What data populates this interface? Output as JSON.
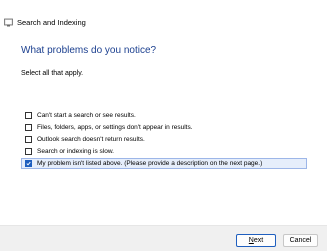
{
  "window": {
    "title": "Search and Indexing",
    "app_icon": "search-indexing-app-icon"
  },
  "wizard": {
    "heading": "What problems do you notice?",
    "instruction": "Select all that apply.",
    "options": [
      {
        "label": "Can't start a search or see results.",
        "checked": false
      },
      {
        "label": "Files, folders, apps, or settings don't appear in results.",
        "checked": false
      },
      {
        "label": "Outlook search doesn't return results.",
        "checked": false
      },
      {
        "label": "Search or indexing is slow.",
        "checked": false
      },
      {
        "label": "My problem isn't listed above. (Please provide a description on the next page.)",
        "checked": true
      }
    ]
  },
  "buttons": {
    "next_first": "N",
    "next_rest": "ext",
    "cancel": "Cancel"
  },
  "colors": {
    "heading": "#1b3f8f",
    "accent": "#1f5fbf",
    "selection_bg": "#e6eefb",
    "footer_bg": "#f0f0f0"
  }
}
